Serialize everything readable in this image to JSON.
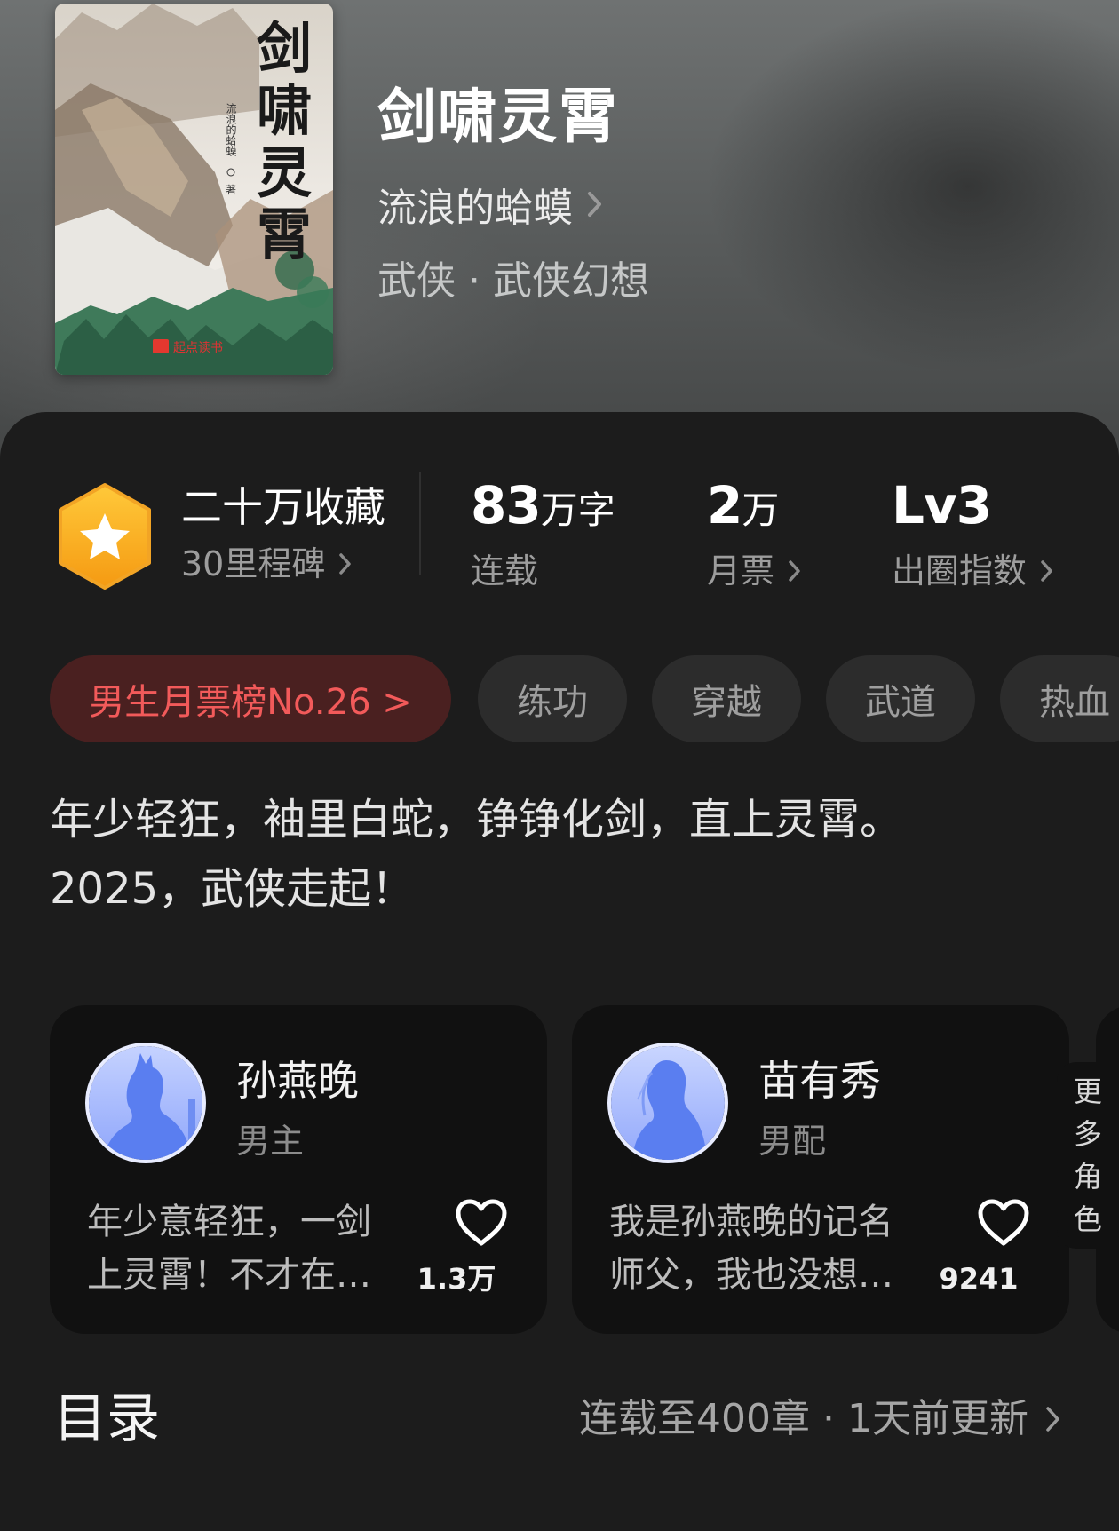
{
  "book": {
    "title": "剑啸灵霄",
    "author": "流浪的蛤蟆",
    "genre": "武侠 · 武侠幻想",
    "cover": {
      "title_chars": [
        "剑",
        "啸",
        "灵",
        "霄"
      ],
      "author_line": "流浪的蛤蟆",
      "author_suffix": "著",
      "publisher": "起点读书"
    }
  },
  "stats": {
    "milestone": {
      "main": "二十万收藏",
      "sub": "30里程碑",
      "icon": "star-hexagon-icon"
    },
    "words": {
      "num": "83",
      "unit": "万字",
      "label": "连载"
    },
    "tickets": {
      "num": "2",
      "unit": "万",
      "label": "月票"
    },
    "circle": {
      "num": "Lv3",
      "label": "出圈指数"
    }
  },
  "tags": {
    "rank": "男生月票榜No.26 >",
    "items": [
      "练功",
      "穿越",
      "武道",
      "热血"
    ]
  },
  "description": {
    "line1": "年少轻狂，袖里白蛇，铮铮化剑，直上灵霄。",
    "line2": "2025，武侠走起！"
  },
  "roles": [
    {
      "name": "孙燕晚",
      "tag": "男主",
      "quote_line1": "年少意轻狂，一剑",
      "quote_line2": "上灵霄！不才在…",
      "likes": "1.3万"
    },
    {
      "name": "苗有秀",
      "tag": "男配",
      "quote_line1": "我是孙燕晚的记名",
      "quote_line2": "师父，我也没想…",
      "likes": "9241"
    }
  ],
  "more_roles": [
    "更",
    "多",
    "角",
    "色"
  ],
  "toc": {
    "title": "目录",
    "meta": "连载至400章 · 1天前更新"
  },
  "colors": {
    "background": "#1c1c1c",
    "card": "#111111",
    "chip": "#2c2c2c",
    "rank_chip_bg": "#4a2020",
    "rank_chip_text": "#f25a5a",
    "badge_gold": "#f7a21c",
    "avatar_blue": "#5b7cf0"
  }
}
